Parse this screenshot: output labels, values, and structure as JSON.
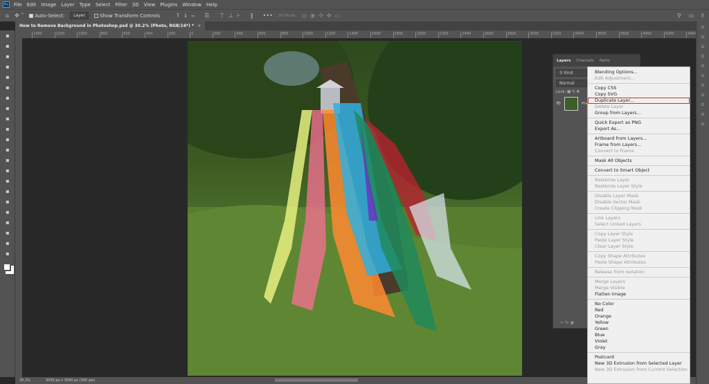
{
  "menubar": {
    "logo": "Ps",
    "items": [
      "File",
      "Edit",
      "Image",
      "Layer",
      "Type",
      "Select",
      "Filter",
      "3D",
      "View",
      "Plugins",
      "Window",
      "Help"
    ]
  },
  "options": {
    "auto_select_label": "Auto-Select:",
    "auto_select_checked": true,
    "target_value": "Layer",
    "show_transform_label": "Show Transform Controls",
    "show_transform_checked": false,
    "mode_3d_label": "3D Mode:"
  },
  "document_tab": {
    "title": "How to Remove Background in Photoshop.psd @ 30.2% (Photo, RGB/16*) *",
    "close": "×"
  },
  "ruler": {
    "labels": [
      "1400",
      "1200",
      "1000",
      "800",
      "600",
      "400",
      "200",
      "0",
      "200",
      "400",
      "600",
      "800",
      "1000",
      "1200",
      "1400",
      "1600",
      "1800",
      "2000",
      "2200",
      "2400",
      "2600",
      "2800",
      "3000",
      "3200",
      "3400",
      "3600",
      "3800",
      "4000",
      "4200",
      "4400"
    ]
  },
  "status": {
    "zoom": "30.2%",
    "doc_info": "3000 px x 3000 px (300 ppi)"
  },
  "layers_panel": {
    "tabs": [
      "Layers",
      "Channels",
      "Paths"
    ],
    "active_tab": "Layers",
    "filter": "Kind",
    "blend_mode": "Normal",
    "lock_label": "Lock:",
    "layer_name": "Photo"
  },
  "context_menu": {
    "groups": [
      [
        {
          "label": "Blending Options...",
          "enabled": true
        },
        {
          "label": "Edit Adjustment...",
          "enabled": false
        }
      ],
      [
        {
          "label": "Copy CSS",
          "enabled": true
        },
        {
          "label": "Copy SVG",
          "enabled": true
        },
        {
          "label": "Duplicate Layer...",
          "enabled": true,
          "highlighted": true
        },
        {
          "label": "Delete Layer",
          "enabled": false
        },
        {
          "label": "Group from Layers...",
          "enabled": true
        }
      ],
      [
        {
          "label": "Quick Export as PNG",
          "enabled": true
        },
        {
          "label": "Export As...",
          "enabled": true
        }
      ],
      [
        {
          "label": "Artboard from Layers...",
          "enabled": true
        },
        {
          "label": "Frame from Layers...",
          "enabled": true
        },
        {
          "label": "Convert to Frame",
          "enabled": false
        }
      ],
      [
        {
          "label": "Mask All Objects",
          "enabled": true
        }
      ],
      [
        {
          "label": "Convert to Smart Object",
          "enabled": true
        }
      ],
      [
        {
          "label": "Rasterize Layer",
          "enabled": false
        },
        {
          "label": "Rasterize Layer Style",
          "enabled": false
        }
      ],
      [
        {
          "label": "Disable Layer Mask",
          "enabled": false
        },
        {
          "label": "Disable Vector Mask",
          "enabled": false
        },
        {
          "label": "Create Clipping Mask",
          "enabled": false
        }
      ],
      [
        {
          "label": "Link Layers",
          "enabled": false
        },
        {
          "label": "Select Linked Layers",
          "enabled": false
        }
      ],
      [
        {
          "label": "Copy Layer Style",
          "enabled": false
        },
        {
          "label": "Paste Layer Style",
          "enabled": false
        },
        {
          "label": "Clear Layer Style",
          "enabled": false
        }
      ],
      [
        {
          "label": "Copy Shape Attributes",
          "enabled": false
        },
        {
          "label": "Paste Shape Attributes",
          "enabled": false
        }
      ],
      [
        {
          "label": "Release from Isolation",
          "enabled": false
        }
      ],
      [
        {
          "label": "Merge Layers",
          "enabled": false
        },
        {
          "label": "Merge Visible",
          "enabled": false
        },
        {
          "label": "Flatten Image",
          "enabled": true
        }
      ],
      [
        {
          "label": "No Color",
          "enabled": true
        },
        {
          "label": "Red",
          "enabled": true
        },
        {
          "label": "Orange",
          "enabled": true
        },
        {
          "label": "Yellow",
          "enabled": true
        },
        {
          "label": "Green",
          "enabled": true
        },
        {
          "label": "Blue",
          "enabled": true
        },
        {
          "label": "Violet",
          "enabled": true
        },
        {
          "label": "Gray",
          "enabled": true
        }
      ],
      [
        {
          "label": "Postcard",
          "enabled": true
        },
        {
          "label": "New 3D Extrusion from Selected Layer",
          "enabled": true
        },
        {
          "label": "New 3D Extrusion from Current Selection",
          "enabled": false
        }
      ]
    ]
  },
  "colors": {
    "highlight": "#d32f2f",
    "panel": "#535353",
    "canvas_bg": "#282828"
  }
}
